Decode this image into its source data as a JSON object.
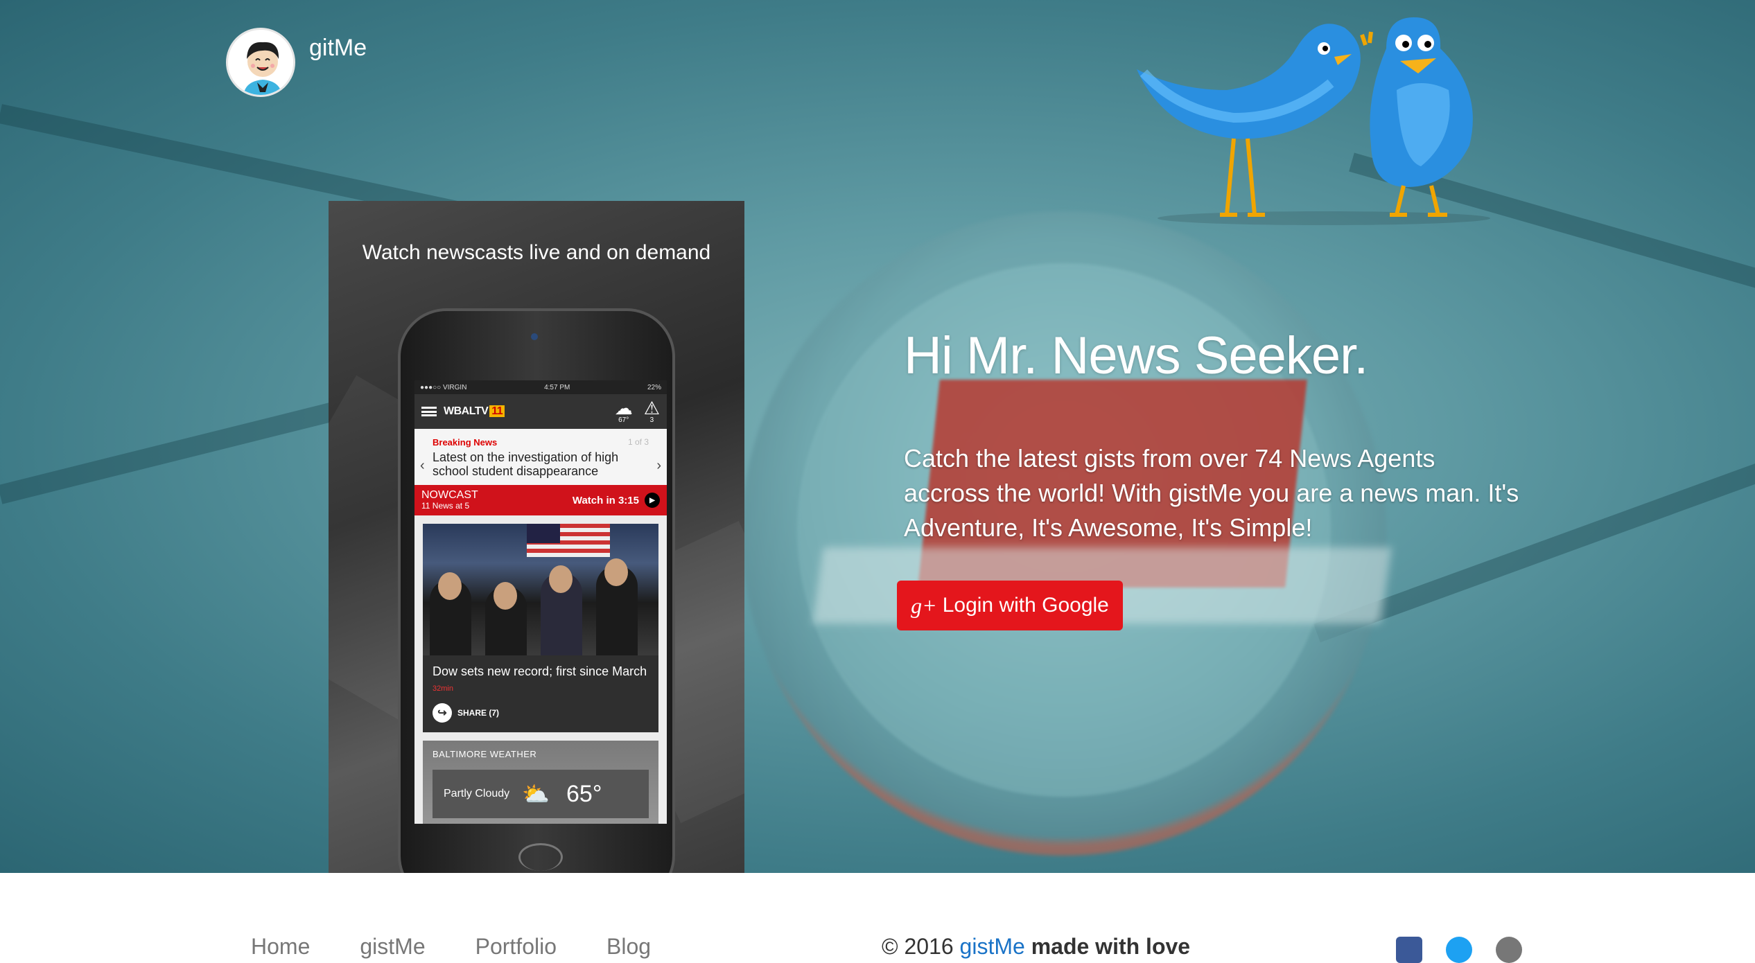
{
  "brand": {
    "name": "gitMe"
  },
  "promo": {
    "caption": "Watch newscasts live and on demand",
    "phone": {
      "status_carrier": "●●●○○ VIRGIN",
      "status_time": "4:57 PM",
      "status_battery": "22%",
      "app_logo": "WBALTV",
      "app_logo_num": "11",
      "weather_temp_small": "67°",
      "alerts_count": "3",
      "breaking_label": "Breaking News",
      "breaking_page": "1 of 3",
      "breaking_headline": "Latest on the investigation of high school student disappearance",
      "nowcast_title": "NOWCAST",
      "nowcast_sub": "11 News at 5",
      "nowcast_watch": "Watch in 3:15",
      "story_headline": "Dow sets new record; first since March",
      "story_age": "32min",
      "story_share": "SHARE (7)",
      "weather_title": "BALTIMORE WEATHER",
      "weather_cond": "Partly Cloudy",
      "weather_temp": "65°"
    }
  },
  "hero": {
    "title": "Hi Mr. News Seeker.",
    "body": "Catch the latest gists from over 74 News Agents accross the world! With gistMe you are a news man. It's Adventure, It's Awesome, It's Simple!",
    "login_label": "Login with Google",
    "login_icon": "g+"
  },
  "footer": {
    "nav": [
      "Home",
      "gistMe",
      "Portfolio",
      "Blog"
    ],
    "copyright_prefix": "© 2016",
    "copyright_link": "gistMe",
    "copyright_suffix": "made with love",
    "social": [
      "facebook-icon",
      "twitter-icon",
      "github-icon"
    ]
  },
  "colors": {
    "accent": "#e4161c",
    "hero_bg": "#4d8c96",
    "link": "#1a73c7"
  }
}
